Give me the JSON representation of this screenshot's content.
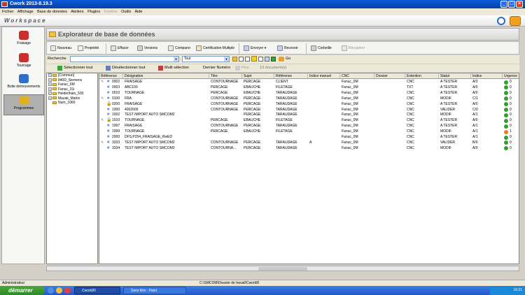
{
  "window": {
    "title": "Cwork 2013-8.19.3"
  },
  "menu": [
    "Fichier",
    "Affichage",
    "Base de données",
    "Ateliers",
    "Plugins",
    "Fenêtre",
    "Outils",
    "Aide"
  ],
  "workspace": {
    "label": "Workspace"
  },
  "nav": [
    {
      "label": "Fraisage",
      "color": "#c83030"
    },
    {
      "label": "Tournage",
      "color": "#c83030"
    },
    {
      "label": "Boite demouvements",
      "color": "#3070c8"
    },
    {
      "label": "Programmes",
      "color": "#e0b020"
    }
  ],
  "panel": {
    "title": "Explorateur de base de données"
  },
  "toolbar": [
    "Nouveau",
    "Propriété",
    "Effacer",
    "Versions",
    "Comparer",
    "Certification Multiple",
    "Envoyer",
    "Recevoir",
    "Corbeille",
    "Récupérer"
  ],
  "search": {
    "label": "Recherche",
    "filter": "Tout",
    "go": "Go"
  },
  "selection": {
    "select_all": "Sélectionner tout",
    "deselect_all": "Désélectionner tout",
    "multi": "Multi sélection",
    "last": "Dernier Numéro",
    "plus": "Plus",
    "count": "13 document(s)"
  },
  "tree": [
    {
      "label": "[Commun]",
      "pm": "+"
    },
    {
      "label": "840D_Siemens",
      "pm": "+"
    },
    {
      "label": "Fanuc_0M",
      "pm": "+"
    },
    {
      "label": "Fanuc_31i",
      "pm": "+"
    },
    {
      "label": "Heidenhain_530",
      "pm": "+"
    },
    {
      "label": "Mazak_Matrix",
      "pm": "+"
    },
    {
      "label": "Num_1060",
      "pm": ""
    }
  ],
  "columns": [
    "Référence",
    "Désignation",
    "Titre",
    "Sujet",
    "Référence",
    "Indice manuel",
    "CNC",
    "Dossier",
    "Extention",
    "Statut",
    "Indice",
    "Urgence"
  ],
  "rows": [
    {
      "pin": true,
      "lock": false,
      "c": [
        "0002",
        "FRAISAGE",
        "CONTOURNAGE",
        "PERCAGE",
        "CLIENT",
        "",
        "Fanuc_0M",
        "",
        "CNC",
        "A TESTER",
        "A/3",
        "0"
      ],
      "st": "#30a030"
    },
    {
      "pin": false,
      "lock": false,
      "c": [
        "0003",
        "ABC100",
        "PERCAGE",
        "EBAUCHE",
        "FILETAGE",
        "",
        "Fanuc_0M",
        "",
        "TXT",
        "A TESTER",
        "A/0",
        "0"
      ],
      "st": "#30a030"
    },
    {
      "pin": false,
      "lock": false,
      "c": [
        "0010",
        " TOURNAGE",
        "PERCAGE",
        "EBAUCHE",
        "TARAUDAGE",
        "",
        "Fanuc_0M",
        "",
        "CNC",
        "A TESTER",
        "A/0",
        "0"
      ],
      "st": "#30a030"
    },
    {
      "pin": true,
      "lock": false,
      "c": [
        "0100",
        "FRA",
        "CONTOURNAGE",
        "PERCAGE",
        "TARAUDAGE",
        "",
        "Fanuc_0M",
        "",
        "CNC",
        "MODIF",
        "C/1",
        "0"
      ],
      "st": "#30a030"
    },
    {
      "pin": false,
      "lock": true,
      "c": [
        "0200",
        "FRAISAGE",
        "CONTOURNAGE",
        "PERCAGE",
        "TARAUDAGE",
        "",
        "Fanuc_0M",
        "",
        "CNC",
        "A TESTER",
        "A/0",
        "0"
      ],
      "st": "#30a030"
    },
    {
      "pin": false,
      "lock": false,
      "c": [
        "1000",
        "4002600",
        "CONTOURNAGE",
        "PERCAGE",
        "TARAUDAGE",
        "",
        "Fanuc_0M",
        "",
        "CNC",
        "VALIDER",
        "C/0",
        "0"
      ],
      "st": "#30a030"
    },
    {
      "pin": false,
      "lock": false,
      "c": [
        "1002",
        "TEST IMPORT AUTO SMCOM2",
        "",
        "PERCAGE",
        "TARAUDAGE",
        "",
        "Fanuc_0M",
        "",
        "CNC",
        "MODIF",
        "A/1",
        "0"
      ],
      "st": "#30a030"
    },
    {
      "pin": true,
      "lock": true,
      "c": [
        "1010",
        " TOURNAGE",
        "PERCAGE",
        "EBAUCHE",
        "FILETAGE",
        "",
        "Fanuc_0M",
        "",
        "CNC",
        "A TESTER",
        "A/0",
        "0"
      ],
      "st": "#30a030"
    },
    {
      "pin": false,
      "lock": false,
      "c": [
        "1997",
        "FRAISAGE",
        "CONTOURNAGE",
        "PERCAGE",
        "TARAUDAGE",
        "",
        "Fanuc_0M",
        "",
        "CNC",
        "A TESTER",
        "A/1",
        "0"
      ],
      "st": "#30a030"
    },
    {
      "pin": false,
      "lock": false,
      "c": [
        "1999",
        " TOURNAGE",
        "PERCAGE",
        "EBAUCHE",
        "FILETAGE",
        "",
        "Fanuc_0M",
        "",
        "CNC",
        "MODIF",
        "A/1",
        "1"
      ],
      "st": "#e08020"
    },
    {
      "pin": false,
      "lock": false,
      "c": [
        "2000",
        "DFS,P254_FRAISAGE_RwED",
        "",
        "",
        "",
        "",
        "Fanuc_0M",
        "",
        "CNC",
        "A TESTER",
        "A/1",
        "0"
      ],
      "st": "#30a030"
    },
    {
      "pin": true,
      "lock": false,
      "c": [
        "3333",
        "TEST IMPORT AUTO SMCOM2",
        "CONTOURNAGE",
        "PERCAGE",
        "TARAUDAGE",
        "A",
        "Fanuc_0M",
        "",
        "CNC",
        "VALIDER",
        "B/0",
        "0"
      ],
      "st": "#30a030"
    },
    {
      "pin": false,
      "lock": false,
      "c": [
        "3334",
        "TEST IMPORT AUTO SMCOM3",
        "CONTOURNA...",
        "PERCAGE",
        "TARAUDAGE",
        "",
        "Fanuc_0M",
        "",
        "CNC",
        "MODIF",
        "A/0",
        "0"
      ],
      "st": "#30a030"
    }
  ],
  "status": {
    "user": "Administrateur",
    "path": "C:\\SMCOM\\Dossier de travail\\Cwork8\\"
  },
  "taskbar": {
    "start": "démarrer",
    "tasks": [
      "Cwork80",
      "Sans titre - Paint"
    ],
    "clock": "16:21"
  }
}
